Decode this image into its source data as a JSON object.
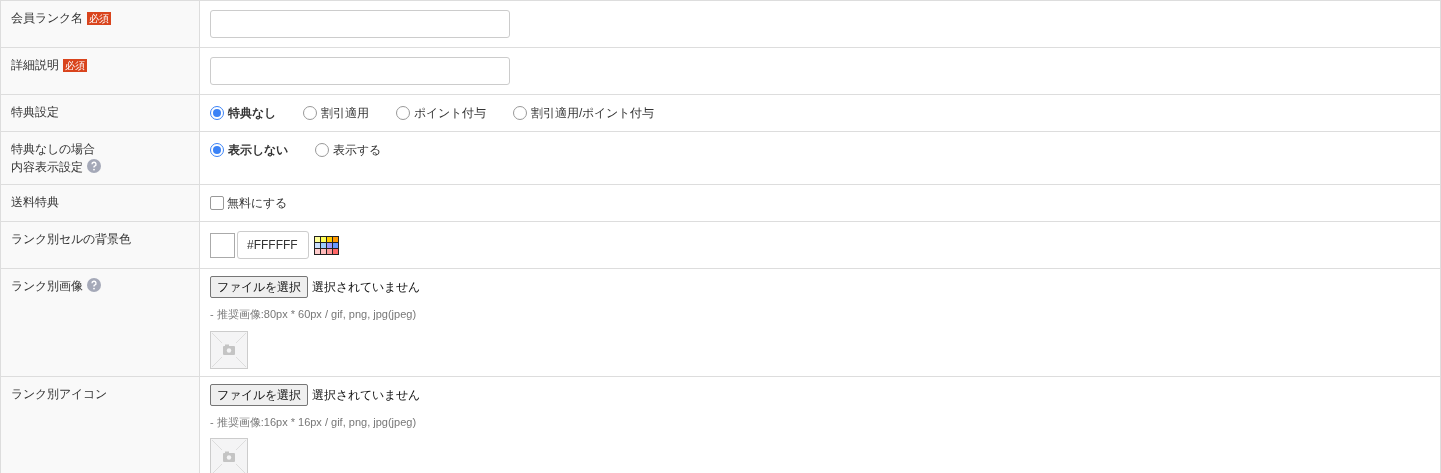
{
  "rows": [
    {
      "kind": "text",
      "label": "会員ランク名",
      "required_badge": "必須"
    },
    {
      "kind": "text",
      "label": "詳細説明",
      "required_badge": "必須"
    },
    {
      "kind": "radio",
      "label": "特典設定",
      "options": [
        {
          "label": "特典なし",
          "selected": true
        },
        {
          "label": "割引適用",
          "selected": false
        },
        {
          "label": "ポイント付与",
          "selected": false
        },
        {
          "label": "割引適用/ポイント付与",
          "selected": false
        }
      ]
    },
    {
      "kind": "radio",
      "label_lines": [
        "特典なしの場合",
        "内容表示設定"
      ],
      "help": true,
      "options": [
        {
          "label": "表示しない",
          "selected": true
        },
        {
          "label": "表示する",
          "selected": false
        }
      ]
    },
    {
      "kind": "checkbox",
      "label": "送料特典",
      "checkbox": {
        "label": "無料にする",
        "checked": false
      }
    },
    {
      "kind": "color",
      "label": "ランク別セルの背景色",
      "value": "#FFFFFF"
    },
    {
      "kind": "file",
      "label": "ランク別画像",
      "help": true,
      "button": "ファイルを選択",
      "status": "選択されていません",
      "hint": "- 推奨画像:80px * 60px / gif, png, jpg(jpeg)"
    },
    {
      "kind": "file",
      "label": "ランク別アイコン",
      "button": "ファイルを選択",
      "status": "選択されていません",
      "hint": "- 推奨画像:16px * 16px / gif, png, jpg(jpeg)"
    }
  ]
}
